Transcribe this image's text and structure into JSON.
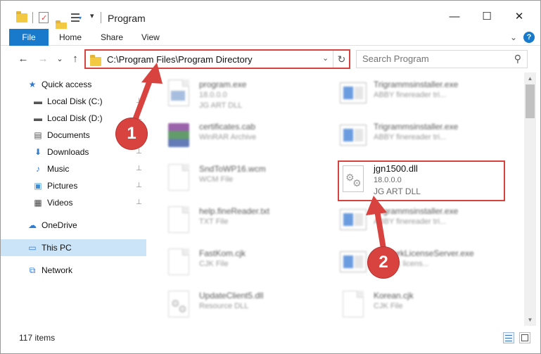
{
  "window": {
    "title": "Program",
    "minimize": "—",
    "maximize": "☐",
    "close": "✕"
  },
  "ribbon": {
    "tabs": [
      "File",
      "Home",
      "Share",
      "View"
    ],
    "expand": "⌄",
    "help": "?"
  },
  "nav": {
    "back": "←",
    "forward": "→",
    "recent": "⌄",
    "up": "↑"
  },
  "address": {
    "path": "C:\\Program Files\\Program Directory",
    "dropdown": "⌄",
    "refresh": "↻"
  },
  "search": {
    "placeholder": "Search Program",
    "icon": "search-icon"
  },
  "sidebar": {
    "items": [
      {
        "label": "Quick access",
        "icon": "star-icon",
        "glyph": "★",
        "color": "#2f7ad3",
        "pinned": false
      },
      {
        "label": "Local Disk (C:)",
        "icon": "drive-icon",
        "glyph": "▬",
        "color": "#555555",
        "pinned": true
      },
      {
        "label": "Local Disk (D:)",
        "icon": "drive-icon",
        "glyph": "▬",
        "color": "#555555",
        "pinned": true
      },
      {
        "label": "Documents",
        "icon": "document-icon",
        "glyph": "▤",
        "color": "#555555",
        "pinned": true
      },
      {
        "label": "Downloads",
        "icon": "download-icon",
        "glyph": "⬇",
        "color": "#2f7ad3",
        "pinned": true
      },
      {
        "label": "Music",
        "icon": "music-icon",
        "glyph": "♪",
        "color": "#2f7ad3",
        "pinned": true
      },
      {
        "label": "Pictures",
        "icon": "pictures-icon",
        "glyph": "▣",
        "color": "#3e8fd8",
        "pinned": true
      },
      {
        "label": "Videos",
        "icon": "video-icon",
        "glyph": "▦",
        "color": "#444444",
        "pinned": true
      },
      {
        "label": "OneDrive",
        "icon": "cloud-icon",
        "glyph": "☁",
        "color": "#2f7ad3",
        "pinned": false
      },
      {
        "label": "This PC",
        "icon": "computer-icon",
        "glyph": "▭",
        "color": "#2f7ad3",
        "pinned": false,
        "selected": true
      },
      {
        "label": "Network",
        "icon": "network-icon",
        "glyph": "⧉",
        "color": "#2f7ad3",
        "pinned": false
      }
    ],
    "pin_glyph": "📌"
  },
  "files": {
    "left": [
      {
        "name": "program.exe",
        "line1": "18.0.0.0",
        "line2": "JG ART DLL",
        "icon": "app-icon"
      },
      {
        "name": "certificates.cab",
        "line1": "WinRAR Archive",
        "line2": "",
        "icon": "winrar-icon"
      },
      {
        "name": "SndToWP16.wcm",
        "line1": "WCM File",
        "line2": "",
        "icon": "file-icon"
      },
      {
        "name": "help.fineReader.txt",
        "line1": "TXT File",
        "line2": "",
        "icon": "file-icon"
      },
      {
        "name": "FastKom.cjk",
        "line1": "CJK File",
        "line2": "",
        "icon": "file-icon"
      },
      {
        "name": "UpdateClient5.dll",
        "line1": "Resource DLL",
        "line2": "",
        "icon": "dll-icon"
      }
    ],
    "right": [
      {
        "name": "Trigrammsinstaller.exe",
        "line1": "ABBY finereader tri...",
        "line2": "",
        "icon": "app-icon"
      },
      {
        "name": "Trigrammsinstaller.exe",
        "line1": "ABBY finereader tri...",
        "line2": "",
        "icon": "app-icon"
      },
      {
        "name": "jgn1500.dll",
        "line1": "18.0.0.0",
        "line2": "JG ART DLL",
        "icon": "dll-icon",
        "highlighted": true
      },
      {
        "name": "Trigrammsinstaller.exe",
        "line1": "ABBY finereader tri...",
        "line2": "",
        "icon": "app-icon"
      },
      {
        "name": "NetworkLicenseServer.exe",
        "line1": "network licens...",
        "line2": "",
        "icon": "app-icon"
      },
      {
        "name": "Korean.cjk",
        "line1": "CJK File",
        "line2": "",
        "icon": "file-icon"
      }
    ]
  },
  "status": {
    "count": "117 items"
  },
  "annotations": {
    "step1": "1",
    "step2": "2",
    "color": "#d9433f"
  }
}
